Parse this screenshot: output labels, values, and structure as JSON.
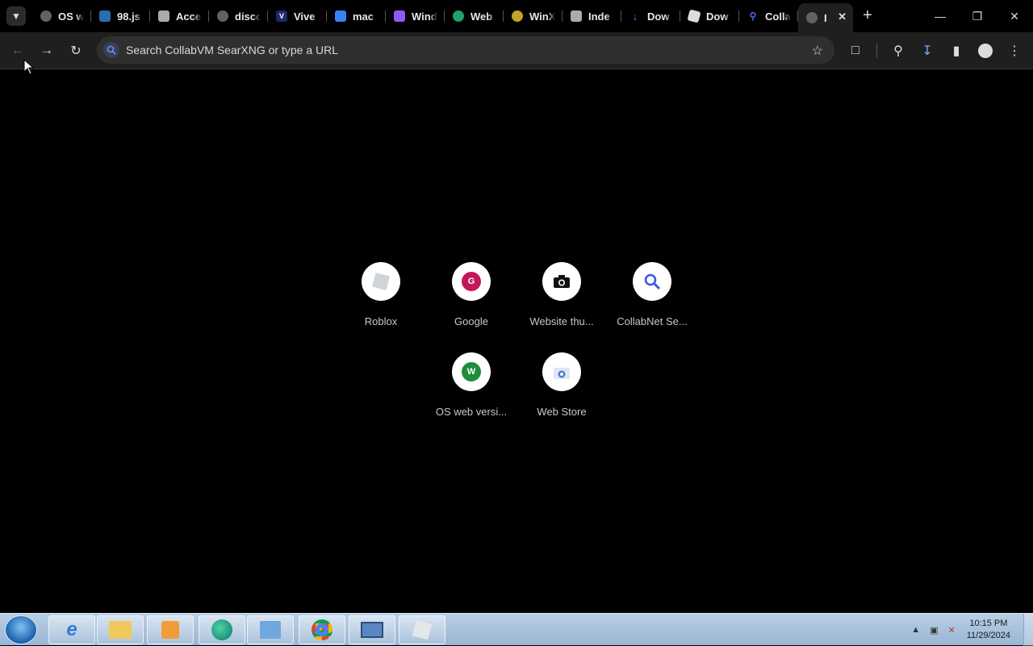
{
  "tabs": [
    {
      "label": "OS w",
      "icon": "globe-icon",
      "color": "#9aa0a6"
    },
    {
      "label": "98.js",
      "icon": "windows98-icon",
      "color": "#2b6cb0"
    },
    {
      "label": "Acce",
      "icon": "wasm-icon",
      "color": "#ccc"
    },
    {
      "label": "disco",
      "icon": "globe-icon",
      "color": "#9aa0a6"
    },
    {
      "label": "Vive",
      "icon": "v9-icon",
      "color": "#1a2b6b"
    },
    {
      "label": "mac",
      "icon": "finder-icon",
      "color": "#3b82f6"
    },
    {
      "label": "Wind",
      "icon": "windows-icon",
      "color": "#8b5cf6"
    },
    {
      "label": "Web",
      "icon": "web-icon",
      "color": "#22a06b"
    },
    {
      "label": "WinX",
      "icon": "winxp-icon",
      "color": "#c4a32a"
    },
    {
      "label": "Inde",
      "icon": "wasm-icon",
      "color": "#ccc"
    },
    {
      "label": "Dow",
      "icon": "download-icon",
      "color": "#3b82f6"
    },
    {
      "label": "Dow",
      "icon": "roblox-icon",
      "color": "#ddd"
    },
    {
      "label": "Colla",
      "icon": "search-icon",
      "color": "#4a6cf7"
    },
    {
      "label": "I",
      "icon": "globe-icon",
      "color": "#9aa0a6",
      "active": true
    }
  ],
  "omnibox": {
    "placeholder": "Search CollabVM SearXNG or type a URL"
  },
  "shortcuts": [
    {
      "label": "Roblox",
      "icon": "roblox-icon"
    },
    {
      "label": "Google",
      "icon": "letter-g-icon",
      "letter": "G",
      "color": "#c2185b"
    },
    {
      "label": "Website thu...",
      "icon": "camera-icon"
    },
    {
      "label": "CollabNet Se...",
      "icon": "search-icon"
    },
    {
      "label": "OS web versi...",
      "icon": "letter-w-icon",
      "letter": "W",
      "color": "#1e8e3e"
    },
    {
      "label": "Web Store",
      "icon": "web-store-icon"
    }
  ],
  "clock": {
    "time": "10:15 PM",
    "date": "11/29/2024"
  }
}
